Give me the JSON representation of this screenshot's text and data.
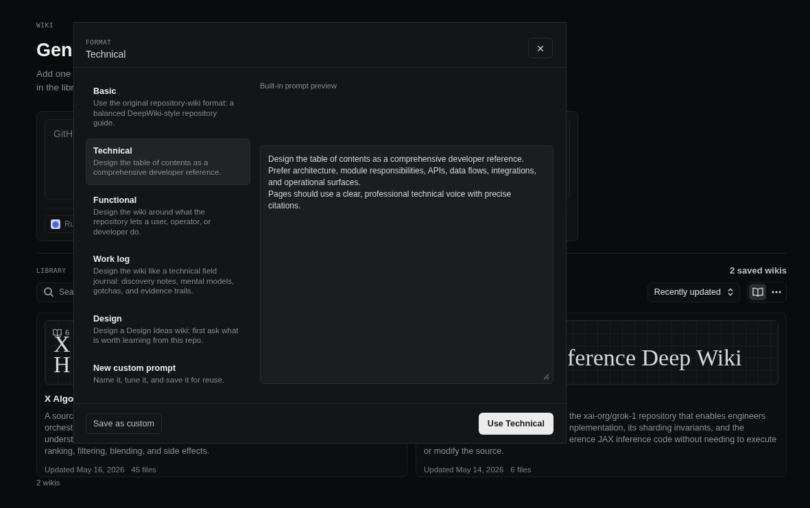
{
  "page": {
    "eyebrow": "WIKI",
    "title": "Gen",
    "intro_lines": [
      "Add one",
      "in the libr"
    ]
  },
  "source_card": {
    "input_placeholder": "GitH",
    "option_label": "Ru"
  },
  "library": {
    "label": "LIBRARY",
    "count": "2 saved wikis",
    "search_placeholder": "Sea",
    "sort": "Recently updated",
    "view_buttons": [
      {
        "kind": "reader",
        "selected": true
      },
      {
        "kind": "more",
        "selected": false
      }
    ],
    "cards": [
      {
        "cover_count": "6",
        "cover_title_lines": [
          "X",
          "H"
        ],
        "cover_covered": false,
        "title": "X Algo",
        "description_lines": [
          {
            "text": "A sourc",
            "covered": false
          },
          {
            "text": "orchest",
            "covered": false
          },
          {
            "text": "underst",
            "covered": false
          },
          {
            "text": "ranking, filtering, blending, and side effects.",
            "covered": false
          }
        ],
        "updated": "Updated May 16, 2026",
        "files": "45 files"
      },
      {
        "cover_title_lines": [
          "ference Deep Wiki"
        ],
        "cover_covered": true,
        "description_lines": [
          {
            "text": "the xai-org/grok-1 repository that enables engineers",
            "covered": true
          },
          {
            "text": "nplementation, its sharding invariants, and the",
            "covered": true
          },
          {
            "text": "erence JAX inference code without needing to execute",
            "covered": true
          },
          {
            "text": "or modify the source.",
            "covered": false
          }
        ],
        "updated": "Updated May 14, 2026",
        "files": "6 files"
      }
    ],
    "footer": "2 wikis"
  },
  "modal": {
    "eyebrow": "FORMAT",
    "title": "Technical",
    "close": "×",
    "formats": [
      {
        "name": "Basic",
        "description": "Use the original repository-wiki format: a balanced DeepWiki-style repository guide.",
        "selected": false
      },
      {
        "name": "Technical",
        "description": "Design the table of contents as a comprehensive developer reference.",
        "selected": true
      },
      {
        "name": "Functional",
        "description": "Design the wiki around what the repository lets a user, operator, or developer do.",
        "selected": false
      },
      {
        "name": "Work log",
        "description": "Design the wiki like a technical field journal: discovery notes, mental models, gotchas, and evidence trails.",
        "selected": false
      },
      {
        "name": "Design",
        "description": "Design a Design Ideas wiki: first ask what is worth learning from this repo.",
        "selected": false
      },
      {
        "name": "New custom prompt",
        "description": "Name it, tune it, and save it for reuse.",
        "selected": false
      }
    ],
    "preview_label": "Built-in prompt preview",
    "preview_text": "Design the table of contents as a comprehensive developer reference.\nPrefer architecture, module responsibilities, APIs, data flows, integrations, and operational surfaces.\nPages should use a clear, professional technical voice with precise citations.",
    "secondary_button": "Save as custom",
    "primary_button": "Use Technical"
  }
}
